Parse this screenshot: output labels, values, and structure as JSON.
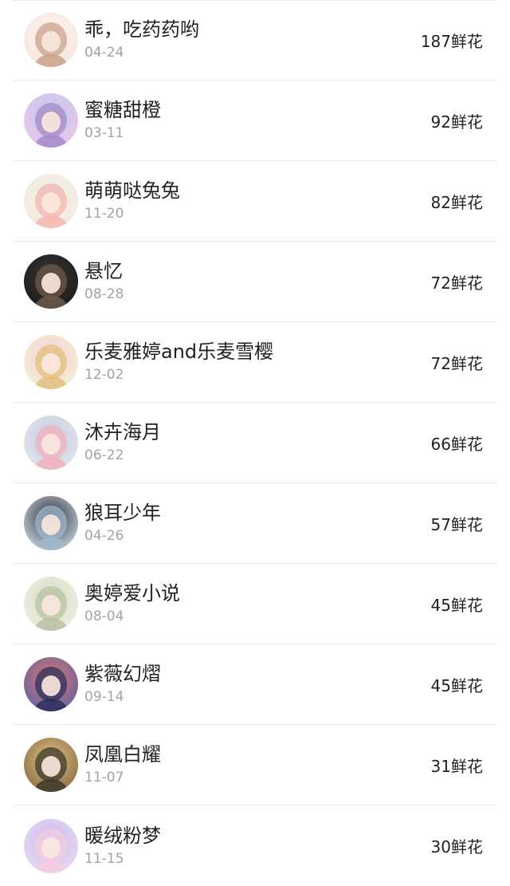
{
  "rows": [
    {
      "name": "乖，吃药药哟",
      "date": "04-24",
      "flowers": "187鲜花",
      "avatar_colors": [
        "#f6e6de",
        "#fdf3ee",
        "#c9a18a"
      ]
    },
    {
      "name": "蜜糖甜橙",
      "date": "03-11",
      "flowers": "92鲜花",
      "avatar_colors": [
        "#f3c6e6",
        "#b9c8f2",
        "#a58bc9"
      ]
    },
    {
      "name": "萌萌哒兔兔",
      "date": "11-20",
      "flowers": "82鲜花",
      "avatar_colors": [
        "#fbe7e0",
        "#e9f2e2",
        "#f4b6b0"
      ]
    },
    {
      "name": "悬忆",
      "date": "08-28",
      "flowers": "72鲜花",
      "avatar_colors": [
        "#1a1a1a",
        "#3a3632",
        "#6b5a4a"
      ]
    },
    {
      "name": "乐麦雅婷and乐麦雪樱",
      "date": "12-02",
      "flowers": "72鲜花",
      "avatar_colors": [
        "#f6efd0",
        "#f2d4dc",
        "#e2c07c"
      ]
    },
    {
      "name": "沐卉海月",
      "date": "06-22",
      "flowers": "66鲜花",
      "avatar_colors": [
        "#e3e6ef",
        "#c7cde0",
        "#f0b1bd"
      ]
    },
    {
      "name": "狼耳少年",
      "date": "04-26",
      "flowers": "57鲜花",
      "avatar_colors": [
        "#cfe0ea",
        "#2a2d38",
        "#9fb9cc"
      ]
    },
    {
      "name": "奥婷爱小说",
      "date": "08-04",
      "flowers": "45鲜花",
      "avatar_colors": [
        "#eef0e0",
        "#d9dccb",
        "#b8c1a3"
      ]
    },
    {
      "name": "紫薇幻熠",
      "date": "09-14",
      "flowers": "45鲜花",
      "avatar_colors": [
        "#5a5fa8",
        "#e07a6a",
        "#2b2f5c"
      ]
    },
    {
      "name": "凤凰白耀",
      "date": "11-07",
      "flowers": "31鲜花",
      "avatar_colors": [
        "#8a6a3c",
        "#d9c08a",
        "#3c3a2a"
      ]
    },
    {
      "name": "暖绒粉梦",
      "date": "11-15",
      "flowers": "30鲜花",
      "avatar_colors": [
        "#e8dcf4",
        "#cdbbea",
        "#f3cde2"
      ]
    }
  ]
}
